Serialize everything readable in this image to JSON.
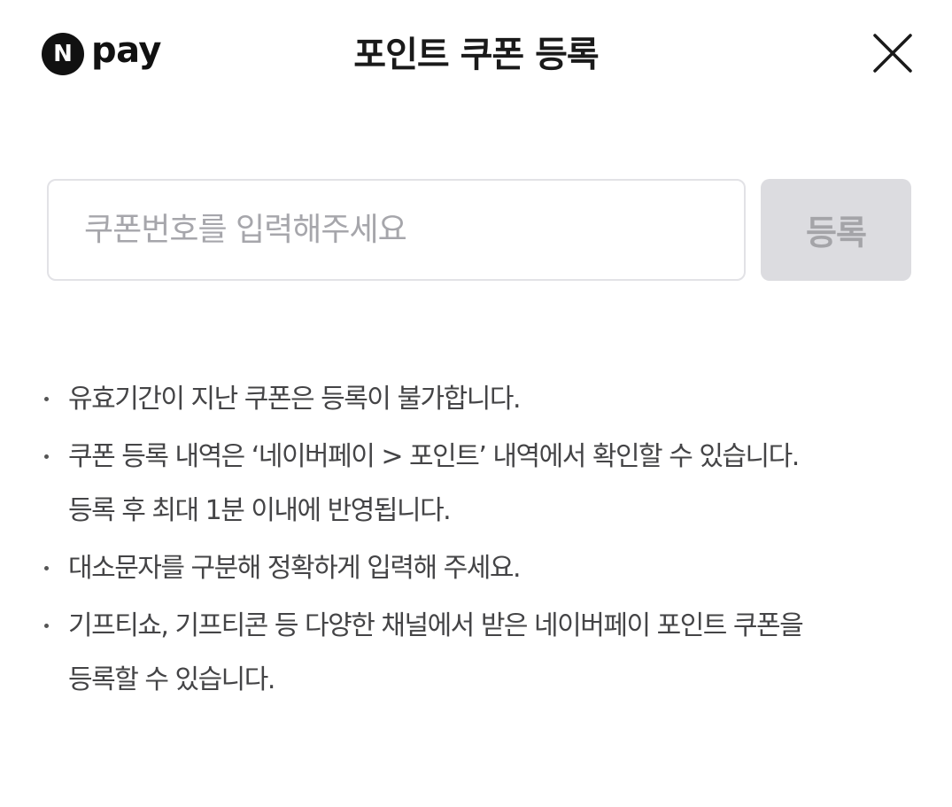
{
  "header": {
    "logo_badge": "N",
    "logo_text": "pay",
    "title": "포인트 쿠폰 등록"
  },
  "form": {
    "placeholder": "쿠폰번호를 입력해주세요",
    "value": "",
    "register_label": "등록"
  },
  "notices": [
    {
      "lines": [
        "유효기간이 지난 쿠폰은 등록이 불가합니다."
      ]
    },
    {
      "lines": [
        "쿠폰 등록 내역은 ‘네이버페이 > 포인트’ 내역에서 확인할 수 있습니다.",
        "등록 후 최대 1분 이내에 반영됩니다."
      ]
    },
    {
      "lines": [
        "대소문자를 구분해 정확하게 입력해 주세요."
      ]
    },
    {
      "lines": [
        "기프티쇼, 기프티콘 등 다양한 채널에서 받은 네이버페이 포인트 쿠폰을",
        "등록할 수 있습니다."
      ]
    }
  ],
  "colors": {
    "brand": "#111111",
    "button_disabled_bg": "#dcdce0",
    "button_disabled_text": "#a4a4a8",
    "input_border": "#e2e2e6"
  },
  "icons": {
    "close": "close-icon"
  }
}
